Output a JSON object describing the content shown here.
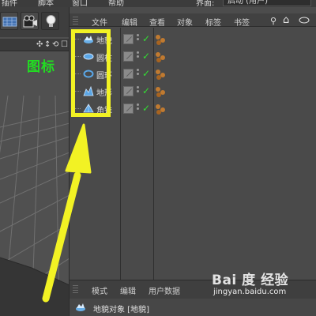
{
  "menubar": {
    "items": [
      "插件",
      "脚本",
      "窗口",
      "帮助"
    ],
    "layout_label": "界面:",
    "layout_value": "启动 (用户)"
  },
  "viewport": {
    "strip_icons": [
      "✣",
      "↕",
      "⟲",
      "☐"
    ],
    "annotation_label": "图标"
  },
  "object_manager": {
    "menu": [
      "文件",
      "编辑",
      "查看",
      "对象",
      "标签",
      "书签"
    ],
    "search_icon": "⚲",
    "home_icon": "⌂",
    "objects": [
      {
        "name": "地貌",
        "icon": "landscape-icon"
      },
      {
        "name": "圆柱",
        "icon": "cylinder-icon"
      },
      {
        "name": "圆环",
        "icon": "torus-icon"
      },
      {
        "name": "地形",
        "icon": "terrain-icon"
      },
      {
        "name": "角锥",
        "icon": "pyramid-icon"
      }
    ],
    "check_mark": "✓"
  },
  "attributes": {
    "menu": [
      "模式",
      "编辑",
      "用户数据"
    ],
    "title": "地貌对象 [地貌]"
  },
  "watermark": {
    "logo": "Bai 度 经验",
    "url": "jingyan.baidu.com"
  },
  "colors": {
    "highlight": "#f2f224",
    "annotation_text": "#22dd22",
    "check": "#33dd33",
    "tag": "#c07a30"
  }
}
